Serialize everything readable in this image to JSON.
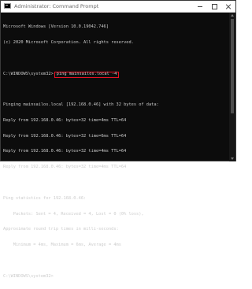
{
  "window": {
    "title": "Administrator: Command Prompt",
    "icon": "cmd-icon",
    "controls": {
      "minimize_icon": "minimize-icon",
      "maximize_icon": "maximize-icon",
      "close_icon": "close-icon"
    }
  },
  "console": {
    "banner_1": "Microsoft Windows [Version 10.0.19042.746]",
    "banner_2": "(c) 2020 Microsoft Corporation. All rights reserved.",
    "prompt_1": "C:\\WINDOWS\\system32>",
    "command": "ping mainsailos.local -4",
    "pinging": "Pinging mainsailos.local [192.168.0.46] with 32 bytes of data:",
    "replies": [
      "Reply from 192.168.0.46: bytes=32 time=4ms TTL=64",
      "Reply from 192.168.0.46: bytes=32 time=6ms TTL=64",
      "Reply from 192.168.0.46: bytes=32 time=4ms TTL=64",
      "Reply from 192.168.0.46: bytes=32 time=4ms TTL=64"
    ],
    "stats_header": "Ping statistics for 192.168.0.46:",
    "stats_packets": "    Packets: Sent = 4, Received = 4, Lost = 0 (0% loss),",
    "rtt_header": "Approximate round trip times in milli-seconds:",
    "rtt_values": "    Minimum = 4ms, Maximum = 6ms, Average = 4ms",
    "prompt_2": "C:\\WINDOWS\\system32>"
  },
  "colors": {
    "console_bg": "#0c0c0c",
    "console_text": "#cccccc",
    "highlight": "#e81123"
  }
}
